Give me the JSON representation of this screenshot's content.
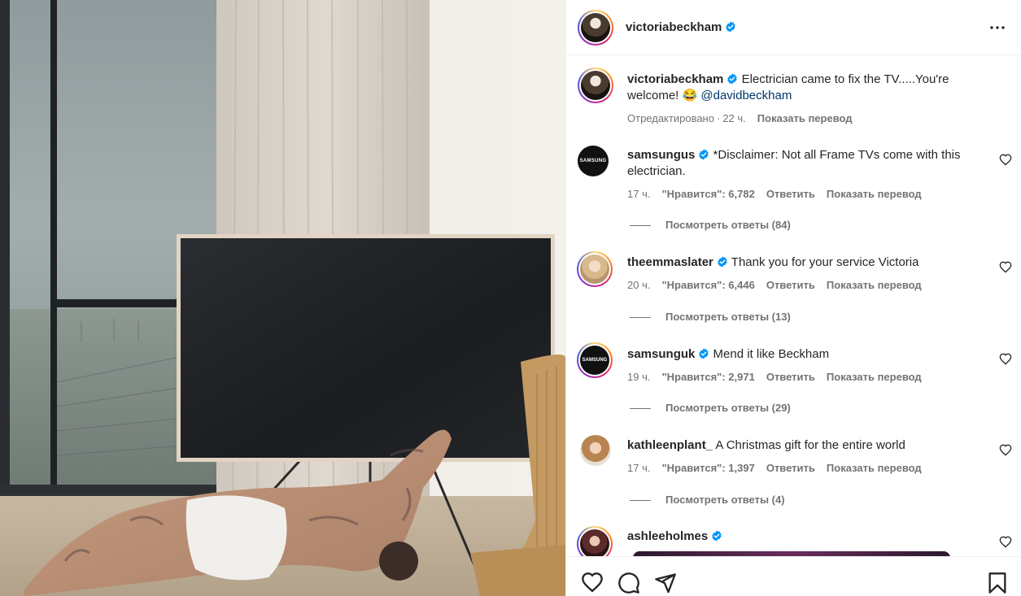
{
  "post": {
    "author": "victoriabeckham",
    "more_icon": "more-horizontal-icon",
    "caption": {
      "author": "victoriabeckham",
      "text": "Electrician came to fix the TV.....You're welcome! 😂",
      "mention": "@davidbeckham",
      "edited": "Отредактировано",
      "separator": "·",
      "time": "22 ч.",
      "translate": "Показать перевод"
    }
  },
  "comments": [
    {
      "user": "samsungus",
      "verified": true,
      "avatar_text": "SAMSUNG",
      "text": "*Disclaimer: Not all Frame TVs come with this electrician.",
      "time": "17 ч.",
      "likes": "\"Нравится\": 6,782",
      "reply": "Ответить",
      "translate": "Показать перевод",
      "view_replies": "Посмотреть ответы (84)"
    },
    {
      "user": "theemmaslater",
      "verified": true,
      "text": "Thank you for your service Victoria",
      "time": "20 ч.",
      "likes": "\"Нравится\": 6,446",
      "reply": "Ответить",
      "translate": "Показать перевод",
      "view_replies": "Посмотреть ответы (13)"
    },
    {
      "user": "samsunguk",
      "verified": true,
      "avatar_text": "SAMSUNG",
      "text": "Mend it like Beckham",
      "time": "19 ч.",
      "likes": "\"Нравится\": 2,971",
      "reply": "Ответить",
      "translate": "Показать перевод",
      "view_replies": "Посмотреть ответы (29)"
    },
    {
      "user": "kathleenplant_",
      "verified": false,
      "text": "A Christmas gift for the entire world",
      "time": "17 ч.",
      "likes": "\"Нравится\": 1,397",
      "reply": "Ответить",
      "translate": "Показать перевод",
      "view_replies": "Посмотреть ответы (4)"
    },
    {
      "user": "ashleeholmes",
      "verified": true
    }
  ],
  "actions": {
    "like_icon": "heart-icon",
    "comment_icon": "comment-icon",
    "share_icon": "share-icon",
    "save_icon": "bookmark-icon"
  },
  "colors": {
    "verified": "#0095f6",
    "mention": "#00376b",
    "muted": "#737373",
    "text": "#262626"
  }
}
